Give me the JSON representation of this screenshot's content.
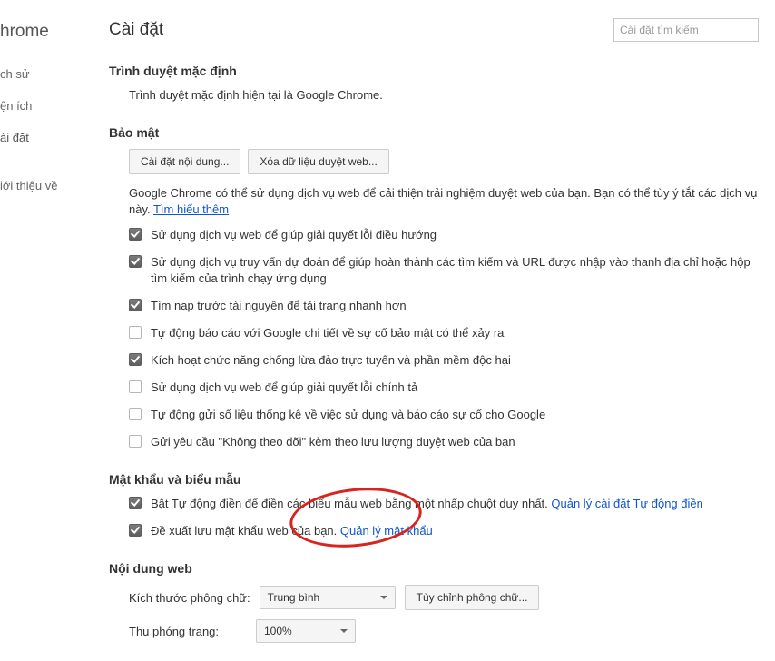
{
  "brand": "hrome",
  "nav": {
    "history": "ch sử",
    "extensions": "ện ích",
    "settings": "ài đặt",
    "about": "iới thiệu về"
  },
  "header": {
    "title": "Cài đặt",
    "search_placeholder": "Cài đặt tìm kiếm"
  },
  "default_browser": {
    "heading": "Trình duyệt mặc định",
    "desc": "Trình duyệt mặc định hiện tại là Google Chrome."
  },
  "security": {
    "heading": "Bảo mật",
    "btn_content": "Cài đặt nội dung...",
    "btn_clear": "Xóa dữ liệu duyệt web...",
    "desc_prefix": "Google Chrome có thể sử dụng dịch vụ web để cải thiện trải nghiệm duyệt web của bạn. Bạn có thể tùy ý tắt các dịch vụ này. ",
    "learn_more": "Tìm hiểu thêm",
    "items": [
      {
        "checked": true,
        "label": "Sử dụng dịch vụ web để giúp giải quyết lỗi điều hướng"
      },
      {
        "checked": true,
        "label": "Sử dụng dịch vụ truy vấn dự đoán để giúp hoàn thành các tìm kiếm và URL được nhập vào thanh địa chỉ hoặc hộp tìm kiếm của trình chạy ứng dụng"
      },
      {
        "checked": true,
        "label": "Tìm nạp trước tài nguyên để tải trang nhanh hơn"
      },
      {
        "checked": false,
        "label": "Tự động báo cáo với Google chi tiết về sự cố bảo mật có thể xảy ra"
      },
      {
        "checked": true,
        "label": "Kích hoạt chức năng chống lừa đảo trực tuyến và phần mềm độc hại"
      },
      {
        "checked": false,
        "label": "Sử dụng dịch vụ web để giúp giải quyết lỗi chính tả"
      },
      {
        "checked": false,
        "label": "Tự động gửi số liệu thống kê về việc sử dụng và báo cáo sự cố cho Google"
      },
      {
        "checked": false,
        "label": "Gửi yêu cầu \"Không theo dõi\" kèm theo lưu lượng duyệt web của bạn"
      }
    ]
  },
  "passwords": {
    "heading": "Mật khẩu và biểu mẫu",
    "autofill_label": "Bật Tự động điền để điền các biểu mẫu web bằng một nhấp chuột duy nhất. ",
    "autofill_link": "Quản lý cài đặt Tự động điền",
    "offer_label": "Đề xuất lưu mật khẩu web của bạn. ",
    "offer_link": "Quản lý mật khẩu"
  },
  "webcontent": {
    "heading": "Nội dung web",
    "font_label": "Kích thước phông chữ:",
    "font_value": "Trung bình",
    "font_btn": "Tùy chỉnh phông chữ...",
    "zoom_label": "Thu phóng trang:",
    "zoom_value": "100%"
  }
}
